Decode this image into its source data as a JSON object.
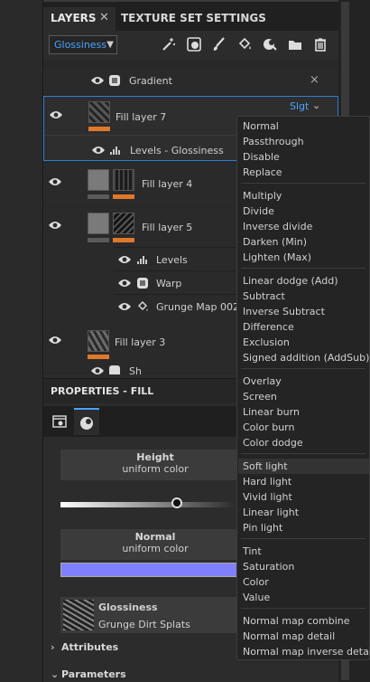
{
  "tabs": {
    "layers": "LAYERS",
    "close": "✕",
    "texture_set_settings": "TEXTURE SET SETTINGS"
  },
  "toolbar": {
    "channel_select": "Glossiness"
  },
  "layers": {
    "gradient": "Gradient",
    "gradient_close": "×",
    "fill7": "Fill layer 7",
    "fill7_blend": "Slgt",
    "levels_gloss": "Levels - Glossiness",
    "fill4": "Fill layer 4",
    "fill5": "Fill layer 5",
    "levels": "Levels",
    "warp": "Warp",
    "grunge": "Grunge Map 002",
    "fill3": "Fill layer 3",
    "partial": "Sh"
  },
  "properties": {
    "title": "PROPERTIES - FILL",
    "height_title": "Height",
    "height_sub": "uniform color",
    "normal_title": "Normal",
    "normal_sub": "uniform color",
    "gloss_title": "Glossiness",
    "gloss_sub": "Grunge Dirt Splats",
    "attributes": "Attributes",
    "parameters": "Parameters",
    "normal_color": "#8080ff"
  },
  "blend_modes": [
    "Normal",
    "Passthrough",
    "Disable",
    "Replace",
    "Multiply",
    "Divide",
    "Inverse divide",
    "Darken (Min)",
    "Lighten (Max)",
    "Linear dodge (Add)",
    "Subtract",
    "Inverse Subtract",
    "Difference",
    "Exclusion",
    "Signed addition (AddSub)",
    "Overlay",
    "Screen",
    "Linear burn",
    "Color burn",
    "Color dodge",
    "Soft light",
    "Hard light",
    "Vivid light",
    "Linear light",
    "Pin light",
    "Tint",
    "Saturation",
    "Color",
    "Value",
    "Normal map combine",
    "Normal map detail",
    "Normal map inverse detail"
  ],
  "selected_blend": "Soft light"
}
